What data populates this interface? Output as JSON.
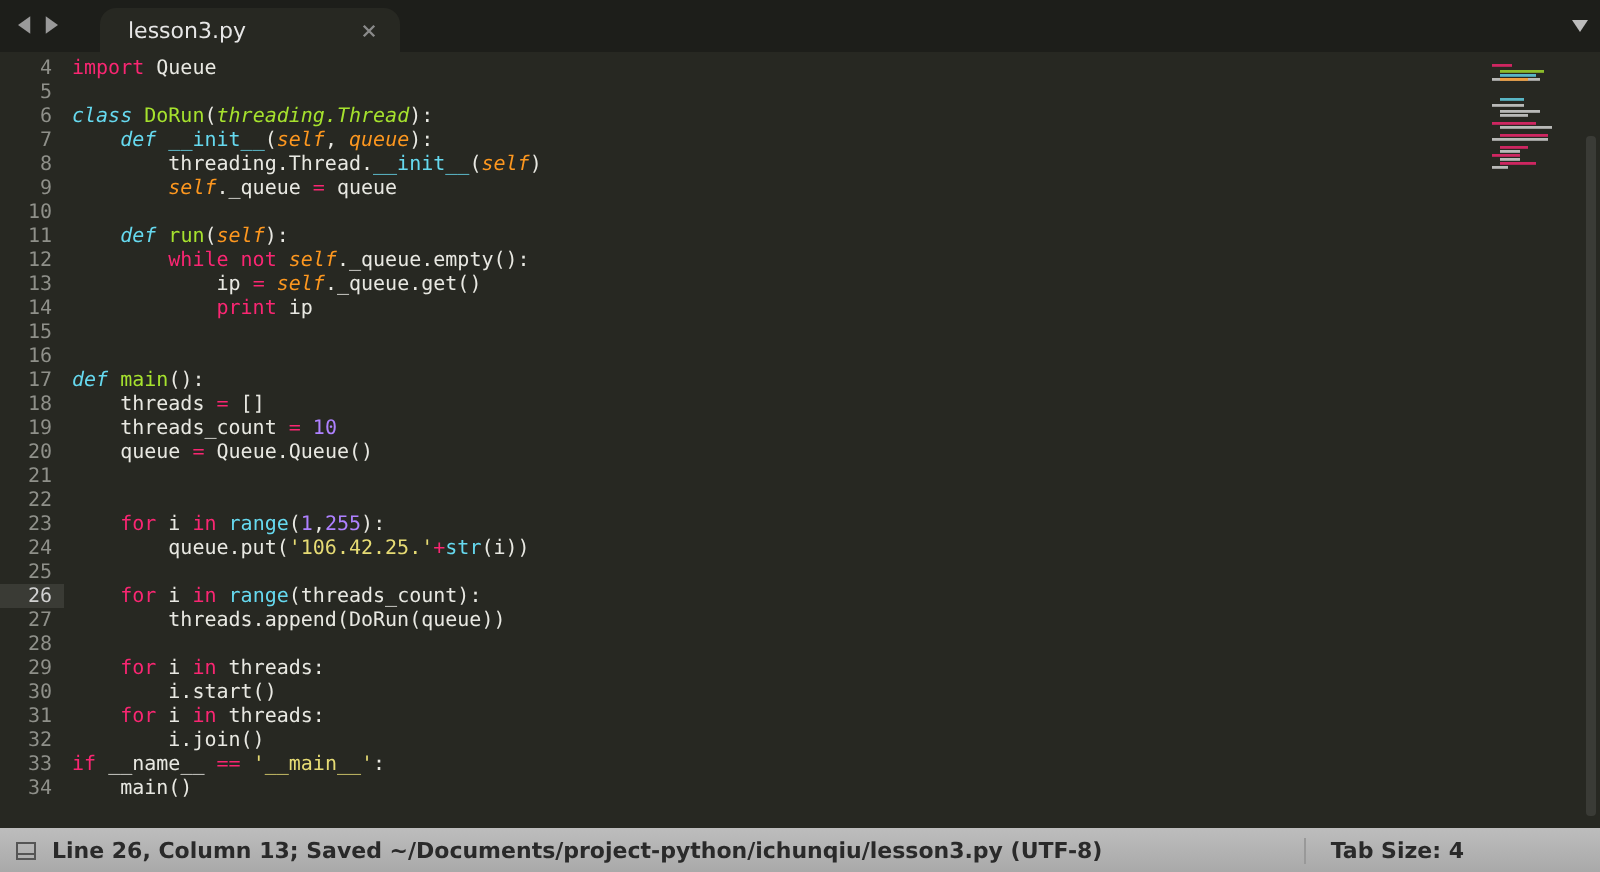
{
  "tab_bar": {
    "tabs": [
      {
        "label": "lesson3.py",
        "selected": true
      }
    ]
  },
  "editor": {
    "lines": [
      {
        "number": "4",
        "current": false,
        "tokens": [
          {
            "t": "import",
            "kind": "keyword"
          },
          {
            "t": " Queue",
            "kind": "plain"
          }
        ]
      },
      {
        "number": "5",
        "current": false
      },
      {
        "number": "6",
        "current": false,
        "tokens": [
          {
            "t": "class ",
            "kind": "storage"
          },
          {
            "t": "DoRun",
            "kind": "name"
          },
          {
            "t": "(",
            "kind": "plain"
          },
          {
            "t": "threading.Thread",
            "kind": "inherit"
          },
          {
            "t": "):",
            "kind": "plain"
          }
        ]
      },
      {
        "number": "7",
        "current": false,
        "tokens": [
          {
            "t": "    def ",
            "kind": "storage"
          },
          {
            "t": "__init__",
            "kind": "builtin"
          },
          {
            "t": "(",
            "kind": "plain"
          },
          {
            "t": "self",
            "kind": "param"
          },
          {
            "t": ", ",
            "kind": "plain"
          },
          {
            "t": "queue",
            "kind": "param"
          },
          {
            "t": "):",
            "kind": "plain"
          }
        ]
      },
      {
        "number": "8",
        "current": false,
        "tokens": [
          {
            "t": "        threading.Thread.",
            "kind": "plain"
          },
          {
            "t": "__init__",
            "kind": "builtin"
          },
          {
            "t": "(",
            "kind": "plain"
          },
          {
            "t": "self",
            "kind": "param"
          },
          {
            "t": ")",
            "kind": "plain"
          }
        ]
      },
      {
        "number": "9",
        "current": false,
        "tokens": [
          {
            "t": "        self",
            "kind": "param"
          },
          {
            "t": "._queue ",
            "kind": "plain"
          },
          {
            "t": "=",
            "kind": "operator"
          },
          {
            "t": " queue",
            "kind": "plain"
          }
        ]
      },
      {
        "number": "10",
        "current": false
      },
      {
        "number": "11",
        "current": false,
        "tokens": [
          {
            "t": "    def ",
            "kind": "storage"
          },
          {
            "t": "run",
            "kind": "name"
          },
          {
            "t": "(",
            "kind": "plain"
          },
          {
            "t": "self",
            "kind": "param"
          },
          {
            "t": "):",
            "kind": "plain"
          }
        ]
      },
      {
        "number": "12",
        "current": false,
        "tokens": [
          {
            "t": "        while not ",
            "kind": "keyword"
          },
          {
            "t": "self",
            "kind": "param"
          },
          {
            "t": "._queue.empty():",
            "kind": "plain"
          }
        ]
      },
      {
        "number": "13",
        "current": false,
        "tokens": [
          {
            "t": "            ip ",
            "kind": "plain"
          },
          {
            "t": "=",
            "kind": "operator"
          },
          {
            "t": " self",
            "kind": "param"
          },
          {
            "t": "._queue.get()",
            "kind": "plain"
          }
        ]
      },
      {
        "number": "14",
        "current": false,
        "tokens": [
          {
            "t": "            print",
            "kind": "keyword"
          },
          {
            "t": " ip",
            "kind": "plain"
          }
        ]
      },
      {
        "number": "15",
        "current": false
      },
      {
        "number": "16",
        "current": false
      },
      {
        "number": "17",
        "current": false,
        "tokens": [
          {
            "t": "def ",
            "kind": "storage"
          },
          {
            "t": "main",
            "kind": "name"
          },
          {
            "t": "():",
            "kind": "plain"
          }
        ]
      },
      {
        "number": "18",
        "current": false,
        "tokens": [
          {
            "t": "    threads ",
            "kind": "plain"
          },
          {
            "t": "=",
            "kind": "operator"
          },
          {
            "t": " []",
            "kind": "plain"
          }
        ]
      },
      {
        "number": "19",
        "current": false,
        "tokens": [
          {
            "t": "    threads_count ",
            "kind": "plain"
          },
          {
            "t": "=",
            "kind": "operator"
          },
          {
            "t": " 10",
            "kind": "number"
          }
        ]
      },
      {
        "number": "20",
        "current": false,
        "tokens": [
          {
            "t": "    queue ",
            "kind": "plain"
          },
          {
            "t": "=",
            "kind": "operator"
          },
          {
            "t": " Queue.Queue()",
            "kind": "plain"
          }
        ]
      },
      {
        "number": "21",
        "current": false
      },
      {
        "number": "22",
        "current": false
      },
      {
        "number": "23",
        "current": false,
        "tokens": [
          {
            "t": "    for",
            "kind": "keyword"
          },
          {
            "t": " i ",
            "kind": "plain"
          },
          {
            "t": "in",
            "kind": "keyword"
          },
          {
            "t": " range",
            "kind": "builtin"
          },
          {
            "t": "(",
            "kind": "plain"
          },
          {
            "t": "1",
            "kind": "number"
          },
          {
            "t": ",",
            "kind": "plain"
          },
          {
            "t": "255",
            "kind": "number"
          },
          {
            "t": "):",
            "kind": "plain"
          }
        ]
      },
      {
        "number": "24",
        "current": false,
        "tokens": [
          {
            "t": "        queue.put(",
            "kind": "plain"
          },
          {
            "t": "'106.42.25.'",
            "kind": "string"
          },
          {
            "t": "+",
            "kind": "operator"
          },
          {
            "t": "str",
            "kind": "builtin"
          },
          {
            "t": "(i))",
            "kind": "plain"
          }
        ]
      },
      {
        "number": "25",
        "current": false
      },
      {
        "number": "26",
        "current": true,
        "tokens": [
          {
            "t": "    for",
            "kind": "keyword"
          },
          {
            "t": " i ",
            "kind": "plain"
          },
          {
            "t": "in",
            "kind": "keyword"
          },
          {
            "t": " range",
            "kind": "builtin"
          },
          {
            "t": "(threads_count):",
            "kind": "plain"
          }
        ]
      },
      {
        "number": "27",
        "current": false,
        "tokens": [
          {
            "t": "        threads.append(DoRun(queue))",
            "kind": "plain"
          }
        ]
      },
      {
        "number": "28",
        "current": false
      },
      {
        "number": "29",
        "current": false,
        "tokens": [
          {
            "t": "    for",
            "kind": "keyword"
          },
          {
            "t": " i ",
            "kind": "plain"
          },
          {
            "t": "in",
            "kind": "keyword"
          },
          {
            "t": " threads:",
            "kind": "plain"
          }
        ]
      },
      {
        "number": "30",
        "current": false,
        "tokens": [
          {
            "t": "        i.start()",
            "kind": "plain"
          }
        ]
      },
      {
        "number": "31",
        "current": false,
        "tokens": [
          {
            "t": "    for",
            "kind": "keyword"
          },
          {
            "t": " i ",
            "kind": "plain"
          },
          {
            "t": "in",
            "kind": "keyword"
          },
          {
            "t": " threads:",
            "kind": "plain"
          }
        ]
      },
      {
        "number": "32",
        "current": false,
        "tokens": [
          {
            "t": "        i.join()",
            "kind": "plain"
          }
        ]
      },
      {
        "number": "33",
        "current": false,
        "tokens": [
          {
            "t": "if",
            "kind": "keyword"
          },
          {
            "t": " __name__ ",
            "kind": "plain"
          },
          {
            "t": "==",
            "kind": "operator"
          },
          {
            "t": " '__main__'",
            "kind": "string"
          },
          {
            "t": ":",
            "kind": "plain"
          }
        ]
      },
      {
        "number": "34",
        "current": false,
        "tokens": [
          {
            "t": "    main()",
            "kind": "plain"
          }
        ]
      }
    ]
  },
  "status_bar": {
    "message": "Line 26, Column 13; Saved ~/Documents/project-python/ichunqiu/lesson3.py (UTF-8)",
    "tab_size": "Tab Size: 4"
  }
}
